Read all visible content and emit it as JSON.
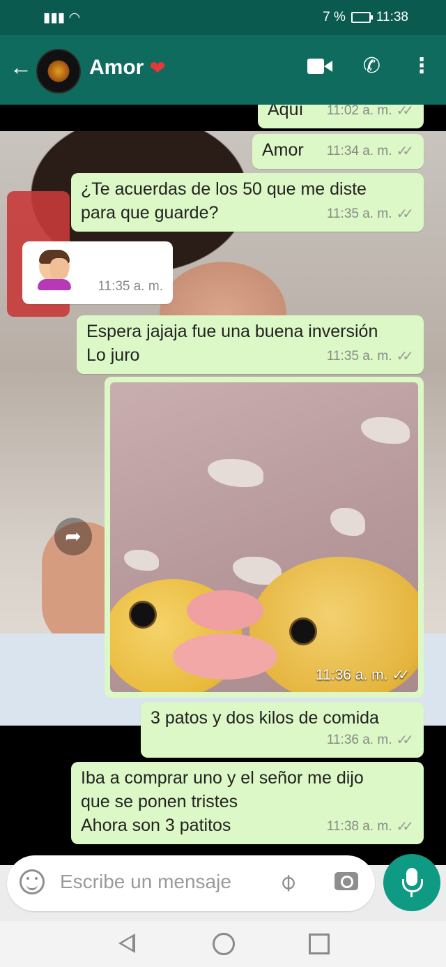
{
  "status_bar": {
    "battery": "7 %",
    "time": "11:38",
    "network_icon": "signal-wifi-icon"
  },
  "header": {
    "contact_name": "Amor",
    "back_icon": "arrow-left-icon",
    "emoji": "red-heart",
    "video_icon": "video-call-icon",
    "call_icon": "phone-icon",
    "menu_icon": "more-vert-icon"
  },
  "messages": [
    {
      "id": "m1",
      "text": "Aquí",
      "time": "11:02 a. m.",
      "direction": "out"
    },
    {
      "id": "m2",
      "text": "Amor",
      "time": "11:34 a. m.",
      "direction": "out"
    },
    {
      "id": "m3",
      "text": "¿Te acuerdas de los 50 que me diste\npara que guarde?",
      "time": "11:35 a. m.",
      "direction": "out"
    },
    {
      "id": "m4",
      "text": "",
      "sticker": "facepalm-emoji",
      "time": "11:35 a. m.",
      "direction": "in"
    },
    {
      "id": "m5",
      "text": "Espera jajaja fue una buena inversión\nLo juro",
      "time": "11:35 a. m.",
      "direction": "out"
    },
    {
      "id": "m6",
      "type": "image",
      "caption": "",
      "time": "11:36 a. m.",
      "direction": "out"
    },
    {
      "id": "m7",
      "text": "3 patos y dos kilos de comida",
      "time": "11:36 a. m.",
      "direction": "out"
    },
    {
      "id": "m8",
      "text": "Iba a comprar uno y el señor me dijo\nque se ponen tristes\nAhora son 3 patitos",
      "time": "11:38 a. m.",
      "direction": "out"
    }
  ],
  "input": {
    "placeholder": "Escribe un mensaje",
    "emoji_icon": "emoji-icon",
    "attach_icon": "paperclip-icon",
    "camera_icon": "camera-icon",
    "mic_icon": "mic-icon"
  },
  "navbar": {
    "back": "nav-back-icon",
    "home": "nav-home-icon",
    "recents": "nav-recents-icon"
  },
  "colors": {
    "header": "#0e6b5d",
    "statusbar": "#0b5a4f",
    "outgoing_bubble": "#dcf8c6",
    "incoming_bubble": "#ffffff",
    "mic_button": "#0f9a83"
  },
  "ticks": "✓✓"
}
